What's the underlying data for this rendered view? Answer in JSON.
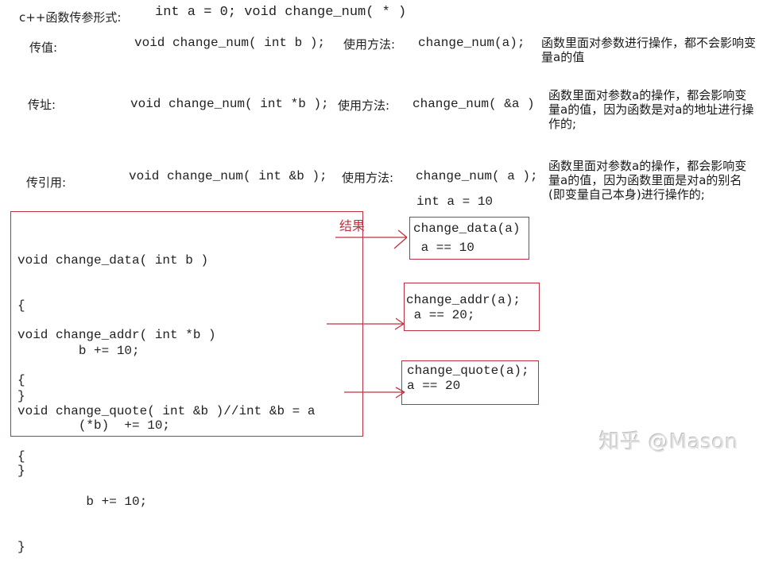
{
  "header": {
    "label": "c++函数传参形式:",
    "code": "int a = 0; void change_num( * )"
  },
  "rows": [
    {
      "label": "传值:",
      "signature": "void change_num( int b );",
      "usage_label": "使用方法:",
      "usage_code": "change_num(a);",
      "description": "函数里面对参数进行操作，都不会影响变量a的值"
    },
    {
      "label": "传址:",
      "signature": "void change_num( int *b );",
      "usage_label": "使用方法:",
      "usage_code": "change_num( &a )",
      "description": "函数里面对参数a的操作，都会影响变量a的值，因为函数是对a的地址进行操作的;"
    },
    {
      "label": "传引用:",
      "signature": "void change_num( int &b );",
      "usage_label": "使用方法:",
      "usage_code": "change_num( a );",
      "description": "函数里面对参数a的操作，都会影响变量a的值，因为函数里面是对a的别名(即变量自己本身)进行操作的;"
    }
  ],
  "init_statement": "int a = 10",
  "result_label": "结果",
  "code_blocks": [
    {
      "lines": [
        "void change_data( int b )",
        "{",
        "        b += 10;",
        "}"
      ]
    },
    {
      "lines": [
        "void change_addr( int *b )",
        "{",
        "        (*b)  += 10;",
        "}"
      ]
    },
    {
      "lines": [
        "void change_quote( int &b )//int &b = a",
        "{",
        "         b += 10;",
        "}"
      ]
    }
  ],
  "results": [
    {
      "call": "change_data(a)",
      "outcome": " a == 10"
    },
    {
      "call": "change_addr(a);",
      "outcome": " a == 20;"
    },
    {
      "call": "change_quote(a);",
      "outcome": "a == 20"
    }
  ],
  "watermark": "知乎 @Mason",
  "colors": {
    "annotation_red": "#c0313f",
    "text": "#222222",
    "background": "#ffffff"
  }
}
